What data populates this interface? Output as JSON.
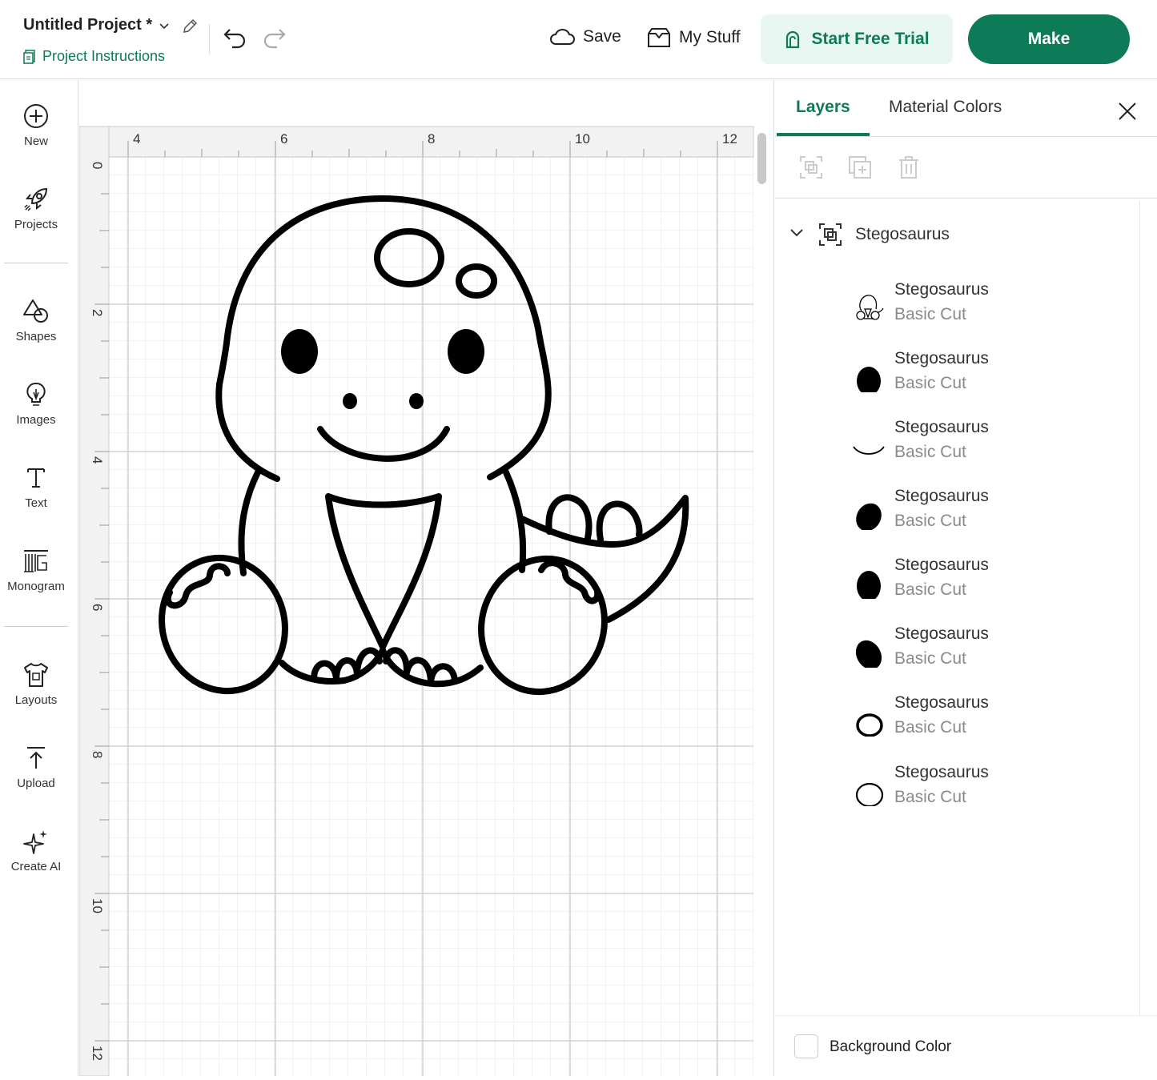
{
  "header": {
    "project_title": "Untitled Project *",
    "project_instructions": "Project Instructions",
    "save_label": "Save",
    "my_stuff_label": "My Stuff",
    "trial_label": "Start Free Trial",
    "make_label": "Make"
  },
  "sidebar": {
    "items": [
      {
        "label": "New",
        "icon": "plus-circle-icon"
      },
      {
        "label": "Projects",
        "icon": "rocket-icon"
      },
      {
        "label": "Shapes",
        "icon": "shapes-icon"
      },
      {
        "label": "Images",
        "icon": "lightbulb-icon"
      },
      {
        "label": "Text",
        "icon": "text-icon"
      },
      {
        "label": "Monogram",
        "icon": "monogram-icon"
      },
      {
        "label": "Layouts",
        "icon": "tshirt-icon"
      },
      {
        "label": "Upload",
        "icon": "upload-icon"
      },
      {
        "label": "Create AI",
        "icon": "sparkle-icon"
      }
    ]
  },
  "canvas": {
    "ruler_top": [
      "4",
      "6",
      "8",
      "10",
      "12"
    ],
    "ruler_left": [
      "0",
      "2",
      "4",
      "6",
      "8",
      "10",
      "12"
    ]
  },
  "panel": {
    "tabs": [
      "Layers",
      "Material Colors"
    ],
    "group_name": "Stegosaurus",
    "layers": [
      {
        "name": "Stegosaurus",
        "type": "Basic Cut",
        "thumb": "dino-outline"
      },
      {
        "name": "Stegosaurus",
        "type": "Basic Cut",
        "thumb": "filled-oval"
      },
      {
        "name": "Stegosaurus",
        "type": "Basic Cut",
        "thumb": "smile-arc"
      },
      {
        "name": "Stegosaurus",
        "type": "Basic Cut",
        "thumb": "filled-oval-tilted"
      },
      {
        "name": "Stegosaurus",
        "type": "Basic Cut",
        "thumb": "filled-oval"
      },
      {
        "name": "Stegosaurus",
        "type": "Basic Cut",
        "thumb": "filled-oval-tilted"
      },
      {
        "name": "Stegosaurus",
        "type": "Basic Cut",
        "thumb": "outline-oval"
      },
      {
        "name": "Stegosaurus",
        "type": "Basic Cut",
        "thumb": "outline-oval"
      }
    ],
    "background_color_label": "Background Color"
  },
  "colors": {
    "accent": "#0d7a58",
    "accent_light": "#e7f6f0"
  }
}
